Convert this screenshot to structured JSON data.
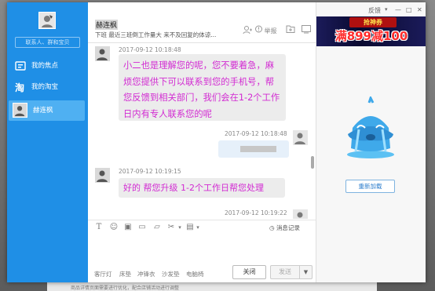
{
  "colors": {
    "sidebar": "#1f8fe6",
    "sidebar_active": "#4fb0f2",
    "message_text": "#d22ad2",
    "bubble": "#ececec"
  },
  "sidebar": {
    "search_placeholder": "联系人、群和宝贝",
    "items": [
      {
        "label": "我的焦点",
        "icon": "focus-icon"
      },
      {
        "label": "我的淘宝",
        "icon": "taobao-icon"
      },
      {
        "label": "赫连枫",
        "icon": "avatar"
      }
    ]
  },
  "header": {
    "contact_name": "赫连枫",
    "status": "下班 最近三班倒工作量大 来不及回复的体谅...",
    "report_label": "举报"
  },
  "messages": [
    {
      "time": "2017-09-12 10:18:48",
      "from": "contact",
      "text": "小二也是理解您的呢，您不要着急，麻烦您提供下可以联系到您的手机号，帮您反馈到相关部门，我们会在1-2个工作日内有专人联系您的呢"
    },
    {
      "time": "2017-09-12 10:18:48",
      "from": "self",
      "text": ""
    },
    {
      "time": "2017-09-12 10:19:15",
      "from": "contact",
      "text": "好的  帮您升级 1-2个工作日帮您处理"
    },
    {
      "time": "2017-09-12 10:19:22",
      "from": "self",
      "text": ""
    }
  ],
  "toolbar": {
    "history_label": "消息记录"
  },
  "quick_phrases": [
    "客厅灯",
    "床垫",
    "冲锋衣",
    "沙发垫",
    "电脑椅"
  ],
  "buttons": {
    "close": "关闭",
    "send": "发送"
  },
  "window": {
    "feedback": "反馈"
  },
  "ad": {
    "top_text": "抢神券",
    "main_text": "满899减100"
  },
  "right_panel": {
    "reload_label": "重新加载"
  },
  "background": {
    "strip_text": "商品详情页面需要进行优化，配合店铺活动进行调整"
  }
}
